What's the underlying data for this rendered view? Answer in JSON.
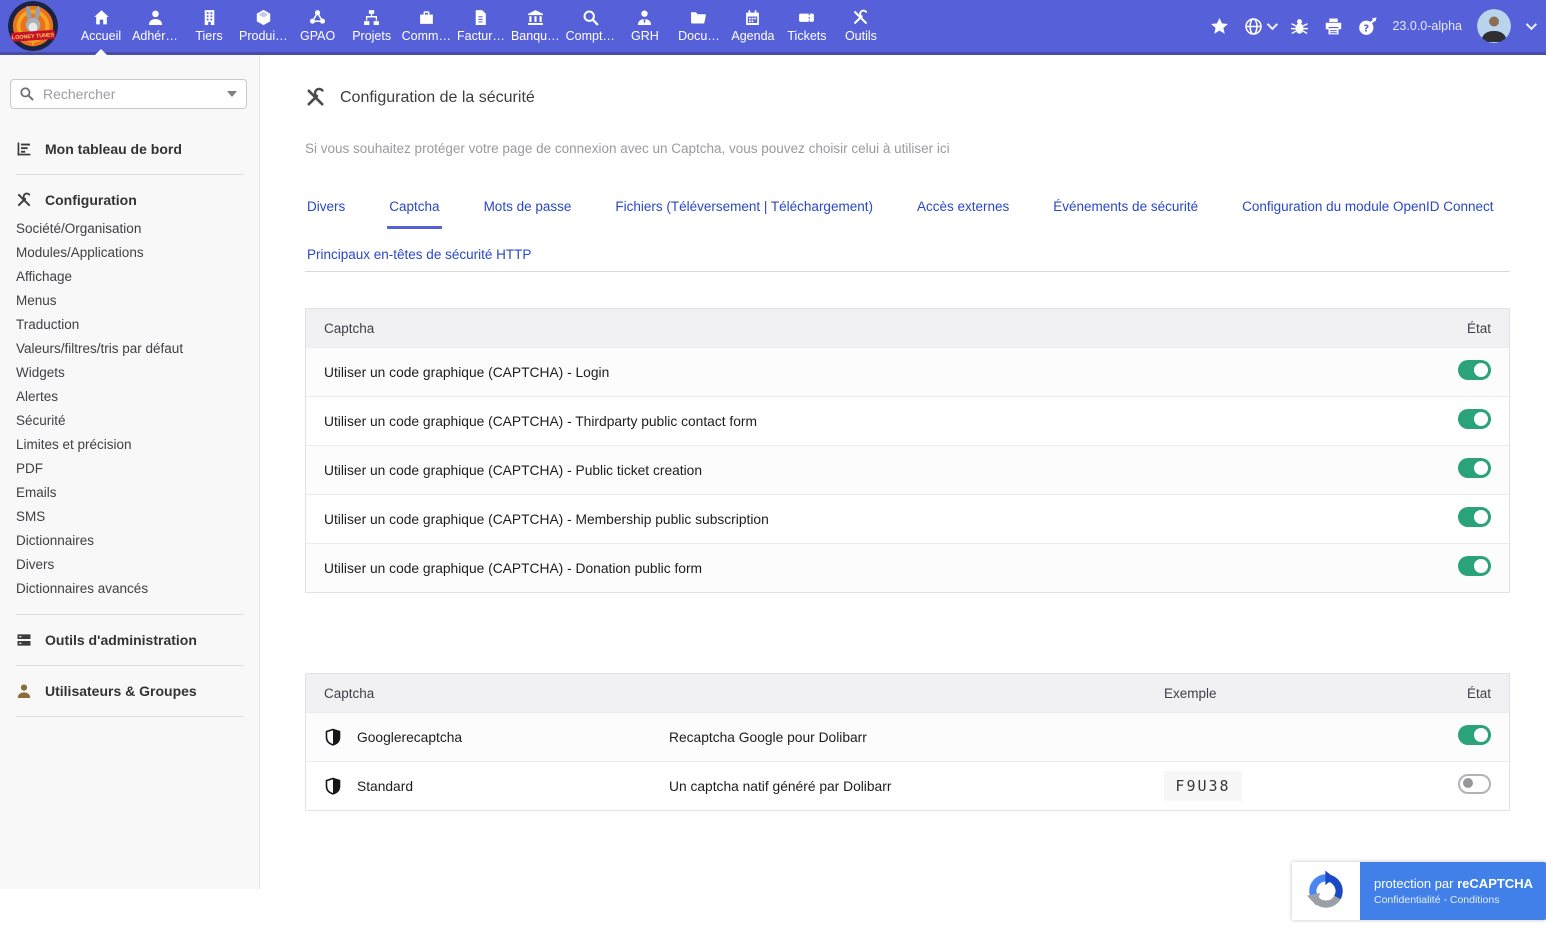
{
  "colors": {
    "navbar": "#5660d8",
    "tab_link": "#2947c5",
    "toggle_on": "#2aa37b",
    "badge_blue": "#4080e8",
    "sidebar_bg": "#f8f8f9"
  },
  "navbar": {
    "version": "23.0.0-alpha",
    "items": [
      {
        "id": "accueil",
        "label": "Accueil",
        "icon": "home",
        "active": true
      },
      {
        "id": "adherents",
        "label": "Adhér…",
        "icon": "user"
      },
      {
        "id": "tiers",
        "label": "Tiers",
        "icon": "building"
      },
      {
        "id": "produits",
        "label": "Produi…",
        "icon": "cube"
      },
      {
        "id": "gpao",
        "label": "GPAO",
        "icon": "nodes"
      },
      {
        "id": "projets",
        "label": "Projets",
        "icon": "sitemap"
      },
      {
        "id": "commerce",
        "label": "Comm…",
        "icon": "briefcase"
      },
      {
        "id": "facturation",
        "label": "Factur…",
        "icon": "bill"
      },
      {
        "id": "banques",
        "label": "Banqu…",
        "icon": "bank"
      },
      {
        "id": "comptabilite",
        "label": "Compt…",
        "icon": "search"
      },
      {
        "id": "grh",
        "label": "GRH",
        "icon": "usertie"
      },
      {
        "id": "documents",
        "label": "Docu…",
        "icon": "folder"
      },
      {
        "id": "agenda",
        "label": "Agenda",
        "icon": "calendar"
      },
      {
        "id": "tickets",
        "label": "Tickets",
        "icon": "ticket"
      },
      {
        "id": "outils",
        "label": "Outils",
        "icon": "tools"
      }
    ]
  },
  "sidebar": {
    "search_placeholder": "Rechercher",
    "dashboard_label": "Mon tableau de bord",
    "configuration_label": "Configuration",
    "configuration_items": [
      "Société/Organisation",
      "Modules/Applications",
      "Affichage",
      "Menus",
      "Traduction",
      "Valeurs/filtres/tris par défaut",
      "Widgets",
      "Alertes",
      "Sécurité",
      "Limites et précision",
      "PDF",
      "Emails",
      "SMS",
      "Dictionnaires",
      "Divers",
      "Dictionnaires avancés"
    ],
    "admin_tools_label": "Outils d'administration",
    "users_groups_label": "Utilisateurs & Groupes"
  },
  "main": {
    "title": "Configuration de la sécurité",
    "description": "Si vous souhaitez protéger votre page de connexion avec un Captcha, vous pouvez choisir celui à utiliser ici",
    "tabs": [
      {
        "label": "Divers"
      },
      {
        "label": "Captcha",
        "active": true
      },
      {
        "label": "Mots de passe"
      },
      {
        "label": "Fichiers (Téléversement | Téléchargement)"
      },
      {
        "label": "Accès externes"
      },
      {
        "label": "Événements de sécurité"
      },
      {
        "label": "Configuration du module OpenID Connect"
      },
      {
        "label": "Principaux en-têtes de sécurité HTTP"
      }
    ],
    "captcha_usage_table": {
      "header_name": "Captcha",
      "header_state": "État",
      "rows": [
        {
          "label": "Utiliser un code graphique (CAPTCHA) - Login",
          "enabled": true
        },
        {
          "label": "Utiliser un code graphique (CAPTCHA) - Thirdparty public contact form",
          "enabled": true
        },
        {
          "label": "Utiliser un code graphique (CAPTCHA) - Public ticket creation",
          "enabled": true
        },
        {
          "label": "Utiliser un code graphique (CAPTCHA) - Membership public subscription",
          "enabled": true
        },
        {
          "label": "Utiliser un code graphique (CAPTCHA) - Donation public form",
          "enabled": true
        }
      ]
    },
    "captcha_providers_table": {
      "header_name": "Captcha",
      "header_example": "Exemple",
      "header_state": "État",
      "rows": [
        {
          "name": "Googlerecaptcha",
          "description": "Recaptcha Google pour Dolibarr",
          "example": "",
          "enabled": true
        },
        {
          "name": "Standard",
          "description": "Un captcha natif généré par Dolibarr",
          "example": "F9U38",
          "enabled": false
        }
      ]
    }
  },
  "recaptcha_badge": {
    "text_prefix": "protection par",
    "brand": "reCAPTCHA",
    "links": "Confidentialité - Conditions"
  }
}
